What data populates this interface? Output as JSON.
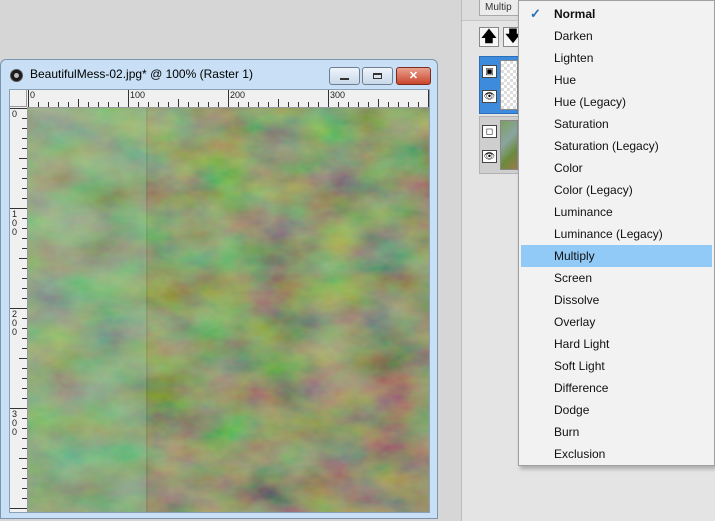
{
  "window": {
    "title": "BeautifulMess-02.jpg* @ 100% (Raster 1)",
    "minimize_icon": "minimize-icon",
    "maximize_icon": "maximize-icon",
    "close_icon": "close-icon"
  },
  "rulers": {
    "top": [
      "0",
      "100",
      "200",
      "300"
    ],
    "left": [
      "0",
      "100",
      "200",
      "300"
    ]
  },
  "layers_panel": {
    "blend_mode_partial": "Multip",
    "buttons": [
      {
        "icon": "move-layer-up-icon",
        "glyph": "🡅"
      },
      {
        "icon": "move-layer-down-icon",
        "glyph": "🡇"
      }
    ],
    "layers": [
      {
        "selected": true,
        "icons": [
          "raster-layer-icon",
          "eye-icon"
        ]
      },
      {
        "selected": false,
        "icons": [
          "background-layer-icon",
          "eye-icon"
        ]
      }
    ]
  },
  "blend_menu": {
    "checked": "Normal",
    "highlighted": "Multiply",
    "items": [
      "Normal",
      "Darken",
      "Lighten",
      "Hue",
      "Hue (Legacy)",
      "Saturation",
      "Saturation (Legacy)",
      "Color",
      "Color (Legacy)",
      "Luminance",
      "Luminance (Legacy)",
      "Multiply",
      "Screen",
      "Dissolve",
      "Overlay",
      "Hard Light",
      "Soft Light",
      "Difference",
      "Dodge",
      "Burn",
      "Exclusion"
    ]
  },
  "colors": {
    "accent": "#3d8bdc",
    "menu_highlight": "#91c9f7"
  }
}
